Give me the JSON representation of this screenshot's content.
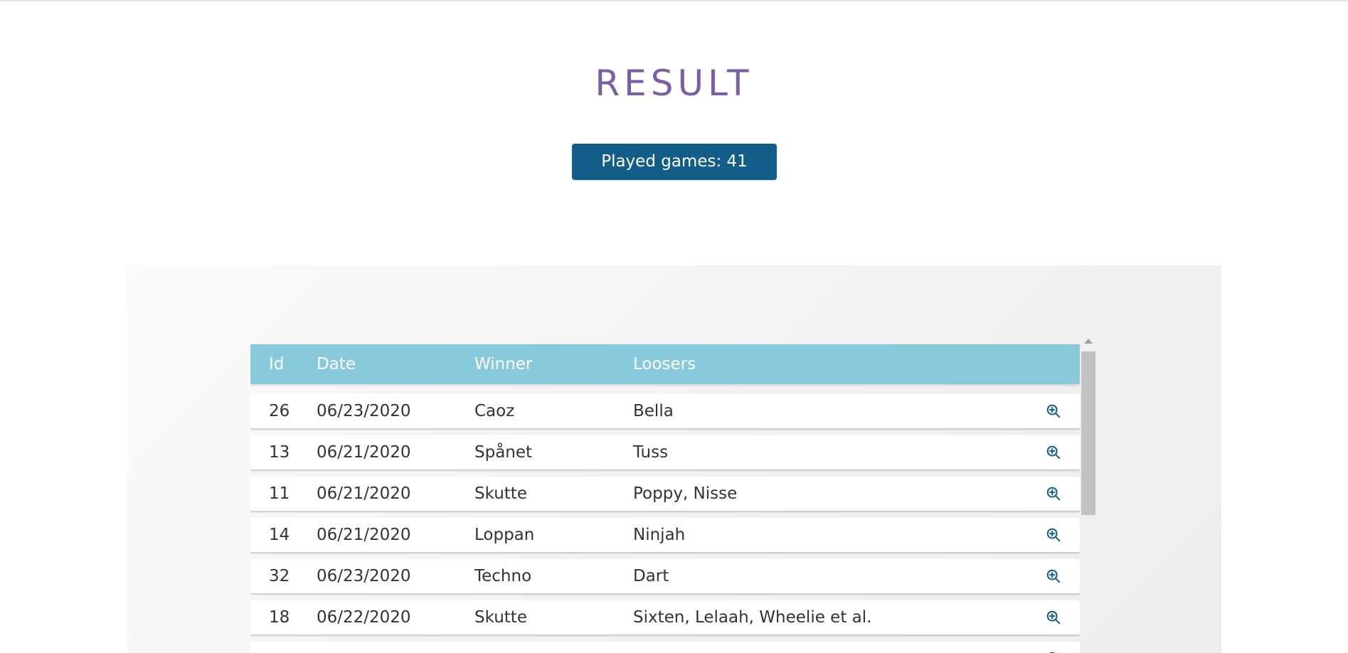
{
  "header": {
    "title": "RESULT",
    "played_games_label": "Played games: 41"
  },
  "table": {
    "columns": {
      "id": "Id",
      "date": "Date",
      "winner": "Winner",
      "loosers": "Loosers"
    },
    "rows": [
      {
        "id": "26",
        "date": "06/23/2020",
        "winner": "Caoz",
        "loosers": "Bella"
      },
      {
        "id": "13",
        "date": "06/21/2020",
        "winner": "Spånet",
        "loosers": "Tuss"
      },
      {
        "id": "11",
        "date": "06/21/2020",
        "winner": "Skutte",
        "loosers": "Poppy, Nisse"
      },
      {
        "id": "14",
        "date": "06/21/2020",
        "winner": "Loppan",
        "loosers": "Ninjah"
      },
      {
        "id": "32",
        "date": "06/23/2020",
        "winner": "Techno",
        "loosers": "Dart"
      },
      {
        "id": "18",
        "date": "06/22/2020",
        "winner": "Skutte",
        "loosers": "Sixten, Lelaah, Wheelie et al."
      },
      {
        "id": "",
        "date": "",
        "winner": "",
        "loosers": ""
      }
    ],
    "row_action_icon": "zoom-in-icon"
  },
  "colors": {
    "title": "#7b5ea7",
    "badge_bg": "#125e88",
    "header_bg": "#89c9dc",
    "icon": "#125e88"
  }
}
